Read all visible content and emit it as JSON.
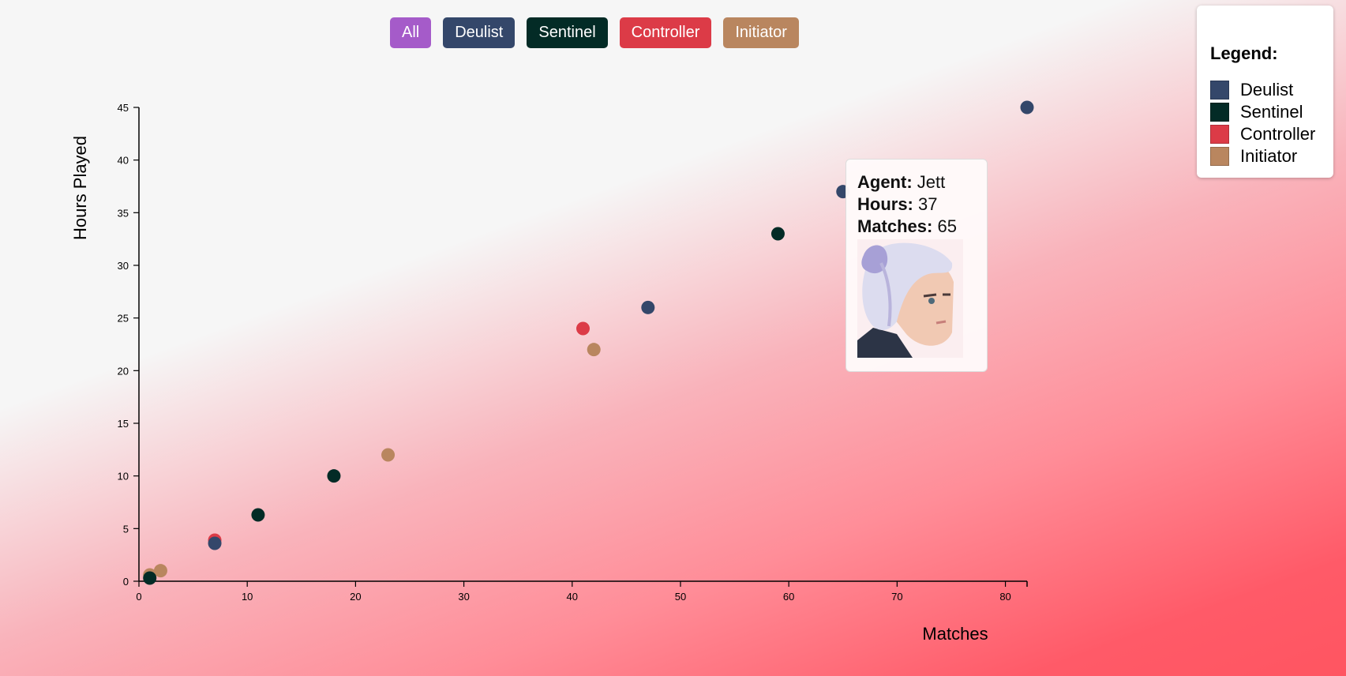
{
  "filters": [
    {
      "label": "All",
      "color": "#a55bc9"
    },
    {
      "label": "Deulist",
      "color": "#34476a"
    },
    {
      "label": "Sentinel",
      "color": "#032b26"
    },
    {
      "label": "Controller",
      "color": "#dc3b47"
    },
    {
      "label": "Initiator",
      "color": "#b9865f"
    }
  ],
  "legend": {
    "title": "Legend:",
    "items": [
      {
        "label": "Deulist",
        "color": "#34476a"
      },
      {
        "label": "Sentinel",
        "color": "#032b26"
      },
      {
        "label": "Controller",
        "color": "#dc3b47"
      },
      {
        "label": "Initiator",
        "color": "#b9865f"
      }
    ]
  },
  "tooltip": {
    "agent_label": "Agent:",
    "agent": "Jett",
    "hours_label": "Hours:",
    "hours": "37",
    "matches_label": "Matches:",
    "matches": "65"
  },
  "chart_data": {
    "type": "scatter",
    "xlabel": "Matches",
    "ylabel": "Hours Played",
    "xlim": [
      0,
      82
    ],
    "ylim": [
      0,
      45
    ],
    "xticks": [
      0,
      10,
      20,
      30,
      40,
      50,
      60,
      70,
      80
    ],
    "yticks": [
      0,
      5,
      10,
      15,
      20,
      25,
      30,
      35,
      40,
      45
    ],
    "grid": false,
    "points": [
      {
        "role": "Deulist",
        "x": 82,
        "y": 45
      },
      {
        "role": "Deulist",
        "x": 65,
        "y": 37
      },
      {
        "role": "Deulist",
        "x": 47,
        "y": 26
      },
      {
        "role": "Controller",
        "x": 7,
        "y": 3.9
      },
      {
        "role": "Deulist",
        "x": 7,
        "y": 3.6
      },
      {
        "role": "Sentinel",
        "x": 59,
        "y": 33
      },
      {
        "role": "Controller",
        "x": 41,
        "y": 24
      },
      {
        "role": "Initiator",
        "x": 42,
        "y": 22
      },
      {
        "role": "Initiator",
        "x": 23,
        "y": 12
      },
      {
        "role": "Sentinel",
        "x": 18,
        "y": 10
      },
      {
        "role": "Sentinel",
        "x": 11,
        "y": 6.3
      },
      {
        "role": "Initiator",
        "x": 2,
        "y": 1
      },
      {
        "role": "Initiator",
        "x": 1,
        "y": 0.6
      },
      {
        "role": "Sentinel",
        "x": 1,
        "y": 0.3
      }
    ]
  }
}
